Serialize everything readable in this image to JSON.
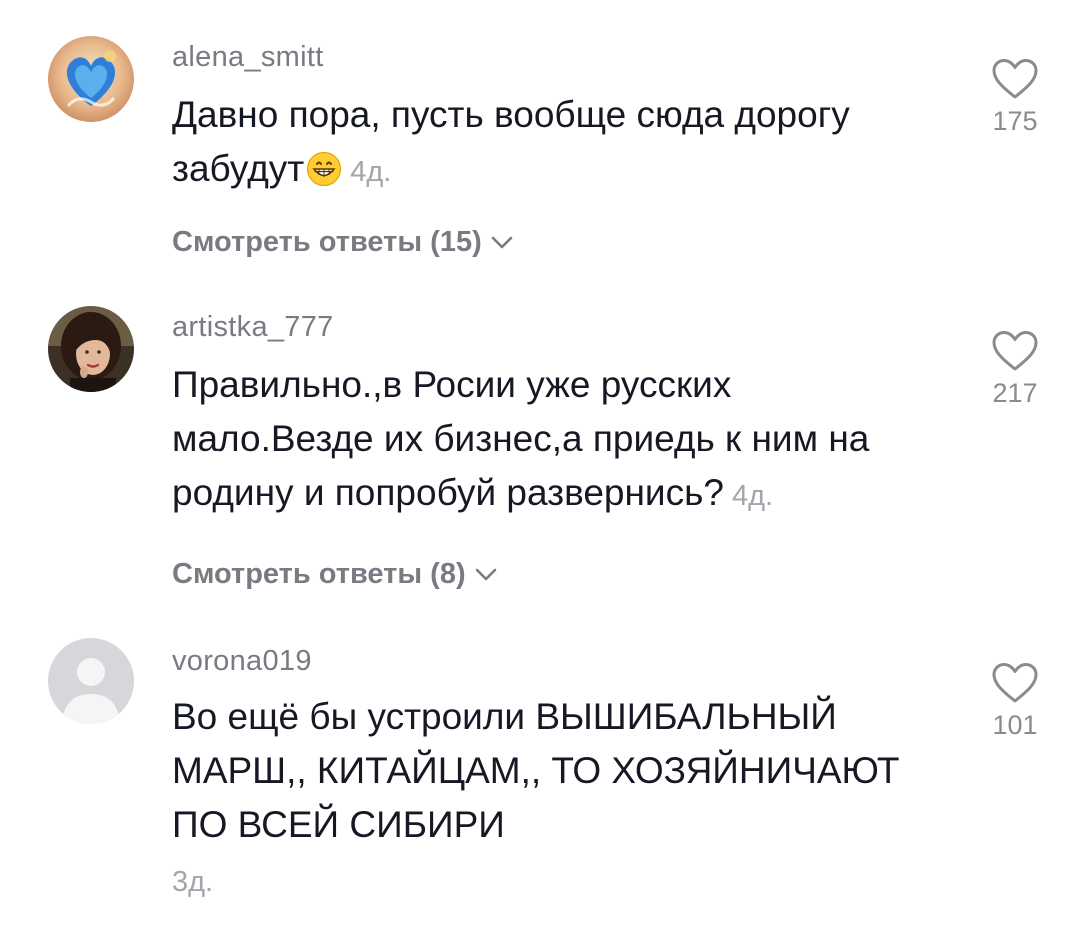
{
  "comments": [
    {
      "username": "alena_smitt",
      "text": "Давно пора, пусть вообще сюда дорогу забудут",
      "emoji": "grinning-face-emoji",
      "time": "4д.",
      "replies_label": "Смотреть ответы (15)",
      "likes": "175",
      "avatar": "avatar-blue-heart"
    },
    {
      "username": "artistka_777",
      "text": "Правильно.,в Росии уже русских мало.Везде их бизнес,а приедь к ним на родину и попробуй развернись?",
      "time": "4д.",
      "replies_label": "Смотреть ответы (8)",
      "likes": "217",
      "avatar": "avatar-woman-portrait"
    },
    {
      "username": "vorona019",
      "text": "Во ещё бы устроили ВЫШИБАЛЬНЫЙ МАРШ,, КИТАЙЦАМ,, ТО ХОЗЯЙНИЧАЮТ ПО ВСЕЙ СИБИРИ",
      "time": "3д.",
      "likes": "101",
      "avatar": "avatar-default-gray"
    }
  ],
  "icons": {
    "like": "heart-outline-icon",
    "expand": "chevron-down-icon"
  },
  "colors": {
    "text": "#161823",
    "secondary": "#7a7b82",
    "muted": "#a4a5ab"
  }
}
